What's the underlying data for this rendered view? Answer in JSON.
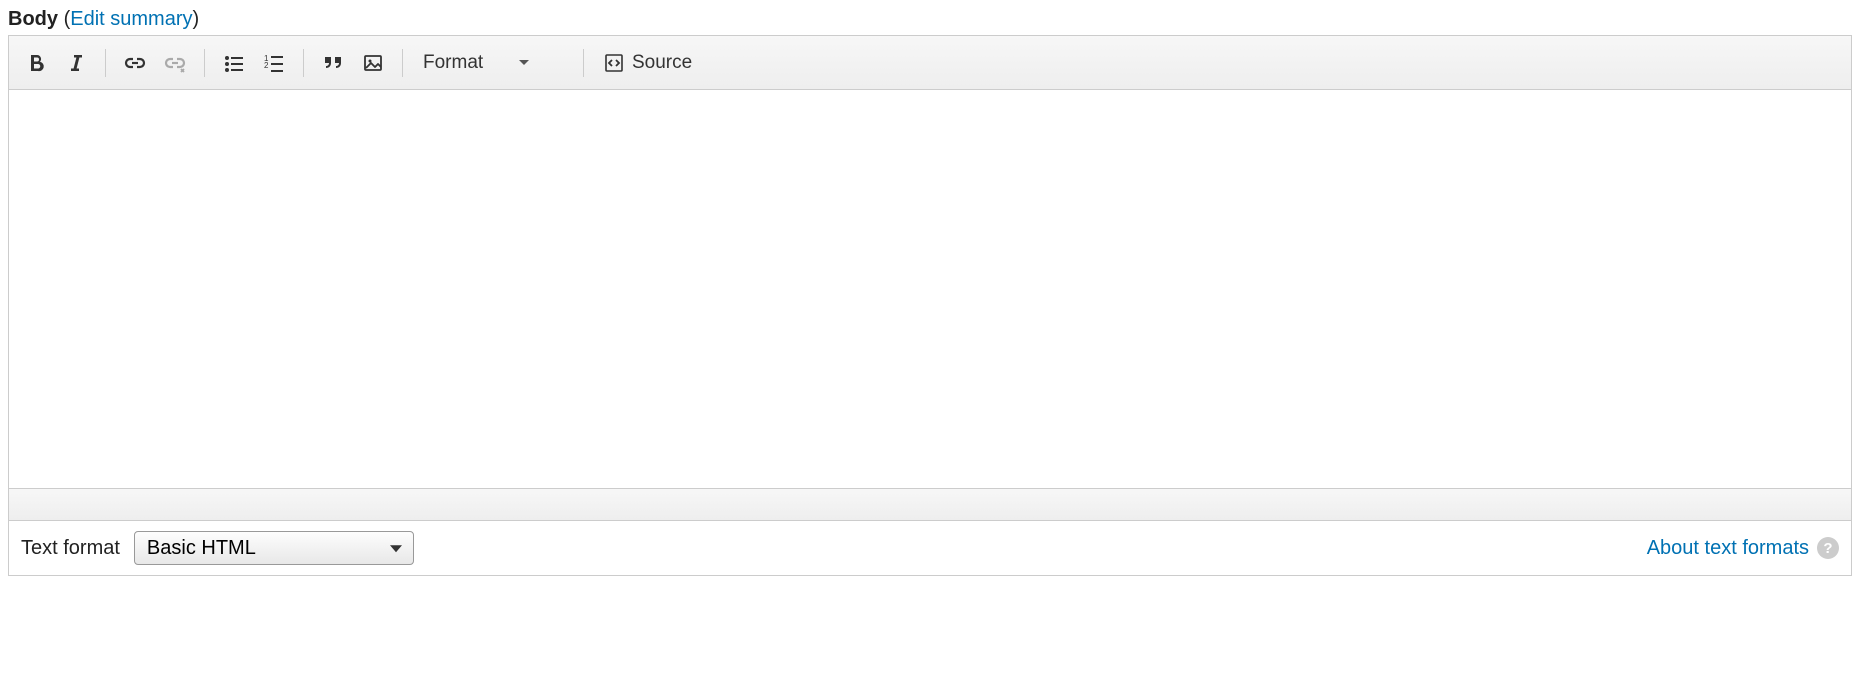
{
  "field": {
    "label": "Body",
    "edit_summary_link": "Edit summary"
  },
  "toolbar": {
    "format_label": "Format",
    "source_label": "Source"
  },
  "editor": {
    "value": ""
  },
  "text_format": {
    "label": "Text format",
    "selected": "Basic HTML",
    "about_link": "About text formats"
  }
}
